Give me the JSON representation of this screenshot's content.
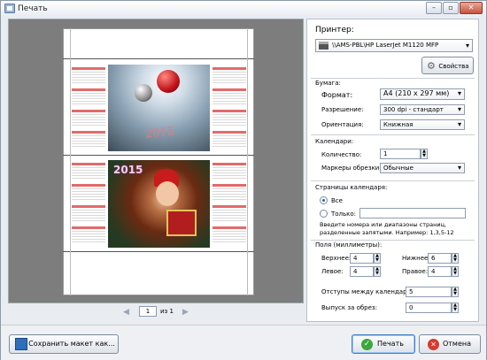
{
  "window": {
    "title": "Печать"
  },
  "preview": {
    "photo_top_year": "2015",
    "photo_bottom_year": "2015",
    "pagination": {
      "current": "1",
      "of_label": "из 1"
    }
  },
  "printer": {
    "section_label": "Принтер:",
    "selected": "\\\\AMS-PBL\\HP LaserJet M1120 MFP",
    "properties_label": "Свойства"
  },
  "paper": {
    "section_label": "Бумага:",
    "format_label": "Формат:",
    "format_value": "A4 (210 x 297 мм)",
    "resolution_label": "Разрешение:",
    "resolution_value": "300 dpi - стандарт",
    "orientation_label": "Ориентация:",
    "orientation_value": "Книжная"
  },
  "calendars": {
    "section_label": "Календари:",
    "count_label": "Количество:",
    "count_value": "1",
    "crop_marks_label": "Маркеры обрезки:",
    "crop_marks_value": "Обычные"
  },
  "calendar_pages": {
    "section_label": "Страницы календаря:",
    "all_label": "Все",
    "only_label": "Только:",
    "only_value": "",
    "hint": "Введите номера или диапазоны страниц, разделенные запятыми. Например: 1,3,5-12"
  },
  "margins": {
    "section_label": "Поля (миллиметры):",
    "top_label": "Верхнее:",
    "top_value": "4",
    "bottom_label": "Нижнее:",
    "bottom_value": "6",
    "left_label": "Левое:",
    "left_value": "4",
    "right_label": "Правое:",
    "right_value": "4",
    "spacing_label": "Отступы между календарями:",
    "spacing_value": "5",
    "bleed_label": "Выпуск за обрез:",
    "bleed_value": "0"
  },
  "footer": {
    "save_layout_label": "Сохранить макет как...",
    "print_label": "Печать",
    "cancel_label": "Отмена"
  }
}
